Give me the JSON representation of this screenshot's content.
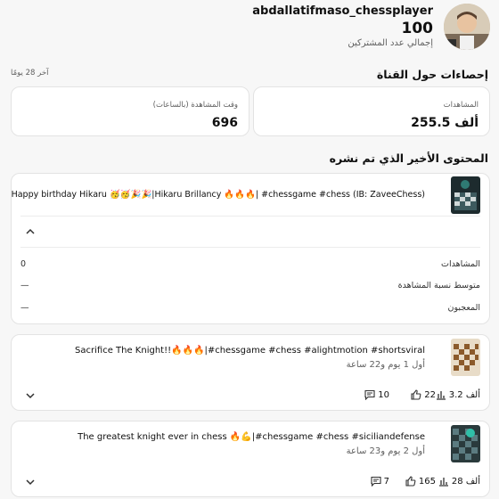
{
  "header": {
    "channel_name": "abdallatifmaso_chessplayer",
    "subscriber_count": "100",
    "subscriber_label": "إجمالي عدد المشتركين"
  },
  "period_label": "آخر 28 يومًا",
  "stats": {
    "title": "إحصاءات حول القناة",
    "views_label": "المشاهدات",
    "views_value": "255.5 ألف",
    "watch_time_label": "وقت المشاهدة (بالساعات)",
    "watch_time_value": "696"
  },
  "recent": {
    "title": "المحتوى الأخير الذي تم نشره",
    "featured": {
      "title": "Happy birthday Hikaru 🥳🥳🎉🎉|Hikaru Brillancy 🔥🔥🔥| #chessgame #chess (IB: ZaveeChess)",
      "rows": [
        {
          "label": "المشاهدات",
          "value": "0"
        },
        {
          "label": "متوسط نسبة المشاهدة",
          "value": "—"
        },
        {
          "label": "المعجبون",
          "value": "—"
        }
      ]
    },
    "videos": [
      {
        "title": "Sacrifice The Knight!!🔥🔥🔥|#chessgame #chess #alightmotion #shortsviral",
        "age": "أول 1 يوم و22 ساعة",
        "views": "3.2 ألف",
        "likes": "22",
        "comments": "10"
      },
      {
        "title": "The greatest knight ever in chess 🔥💪|#chessgame #chess #siciliandefense",
        "age": "أول 2 يوم و23 ساعة",
        "views": "28 ألف",
        "likes": "165",
        "comments": "7"
      }
    ]
  },
  "colors": {
    "background": "#f7f7f7",
    "card": "#ffffff",
    "text": "#0f0f0f",
    "secondary": "#606060"
  }
}
